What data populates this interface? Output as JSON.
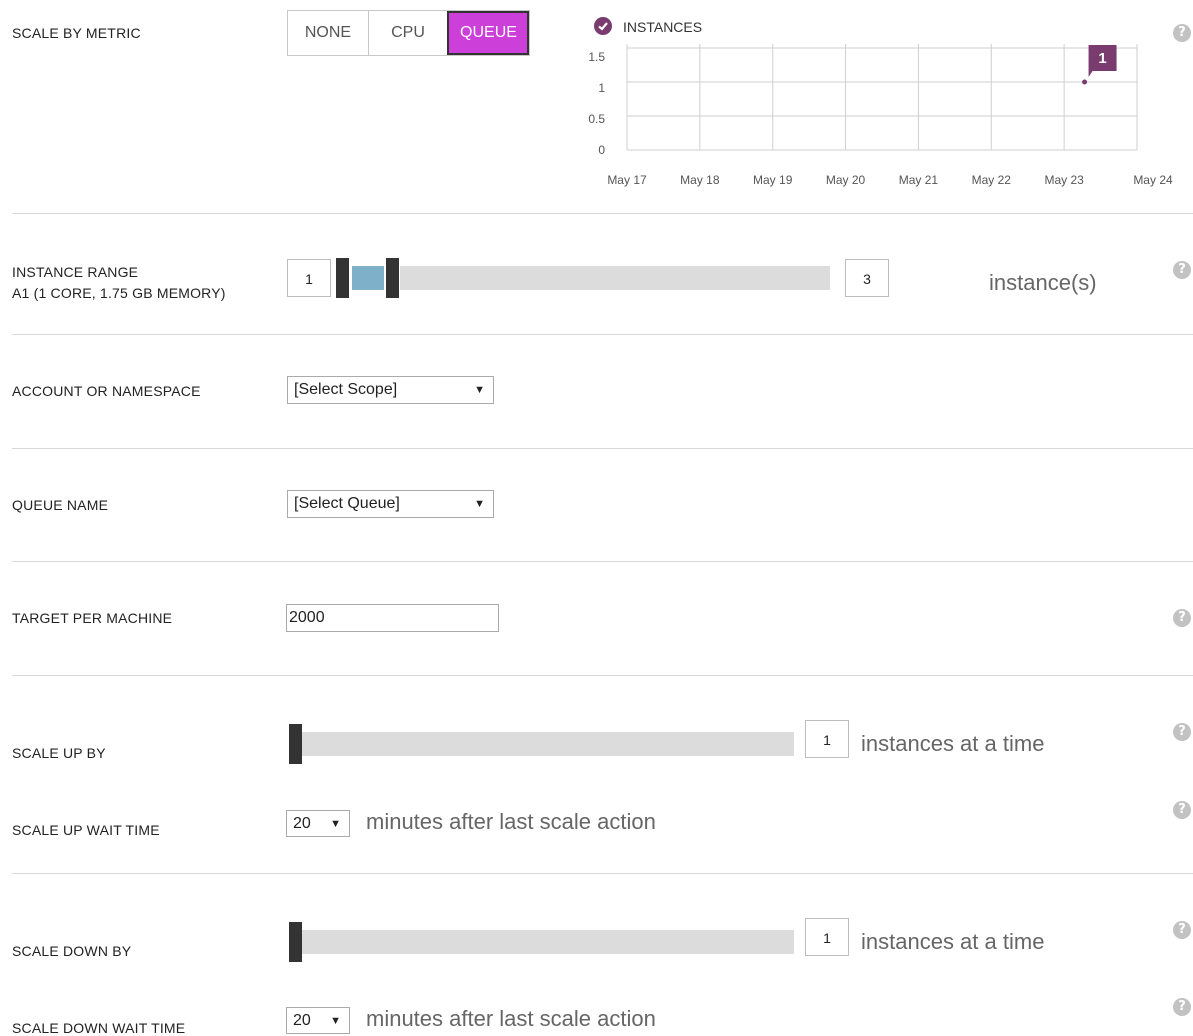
{
  "scale_by_metric": {
    "label": "SCALE BY METRIC",
    "options": [
      "NONE",
      "CPU",
      "QUEUE"
    ],
    "selected": "QUEUE"
  },
  "chart": {
    "legend_label": "INSTANCES",
    "marker_label": "1"
  },
  "chart_data": {
    "type": "line",
    "x_tick_labels": [
      "May 17",
      "May 18",
      "May 19",
      "May 20",
      "May 21",
      "May 22",
      "May 23",
      "May 24"
    ],
    "y_tick_labels": [
      "1.5",
      "1",
      "0.5",
      "0"
    ],
    "ylim": [
      0,
      1.5
    ],
    "series": [
      {
        "name": "INSTANCES",
        "x": [
          "May 23.5"
        ],
        "y": [
          1
        ]
      }
    ],
    "legend": "top-left",
    "grid": true
  },
  "instance_range": {
    "label_line1": "INSTANCE RANGE",
    "label_line2": "A1 (1 CORE, 1.75 GB MEMORY)",
    "min": "1",
    "max": "3",
    "unit": "instance(s)"
  },
  "account": {
    "label": "ACCOUNT OR NAMESPACE",
    "value": "[Select Scope]"
  },
  "queue": {
    "label": "QUEUE NAME",
    "value": "[Select Queue]"
  },
  "target": {
    "label": "TARGET PER MACHINE",
    "value": "2000"
  },
  "scale_up": {
    "by_label": "SCALE UP BY",
    "by_value": "1",
    "by_unit": "instances at a time",
    "wait_label": "SCALE UP WAIT TIME",
    "wait_value": "20",
    "wait_unit": "minutes after last scale action"
  },
  "scale_down": {
    "by_label": "SCALE DOWN BY",
    "by_value": "1",
    "by_unit": "instances at a time",
    "wait_label": "SCALE DOWN WAIT TIME",
    "wait_value": "20",
    "wait_unit": "minutes after last scale action"
  },
  "help_glyph": "?",
  "colors": {
    "accent": "#cc3fd9",
    "chart_marker": "#7a3b6e",
    "range_fill": "#7fb0c9"
  }
}
